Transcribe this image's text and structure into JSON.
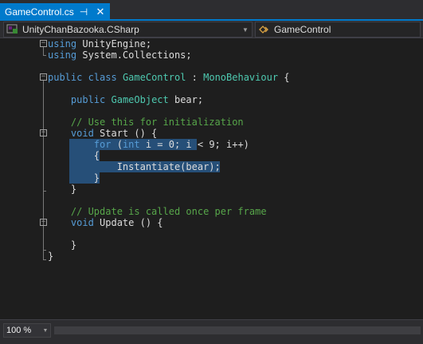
{
  "tab": {
    "title": "GameControl.cs",
    "pin_glyph": "⊣",
    "close_glyph": "✕"
  },
  "navbar": {
    "project": "UnityChanBazooka.CSharp",
    "member": "GameControl",
    "arrow": "▼"
  },
  "code": {
    "lines": [
      [
        [
          "kw",
          "using"
        ],
        [
          "tx",
          " UnityEngine;"
        ]
      ],
      [
        [
          "kw",
          "using"
        ],
        [
          "tx",
          " System.Collections;"
        ]
      ],
      [],
      [
        [
          "kw",
          "public"
        ],
        [
          "tx",
          " "
        ],
        [
          "kw",
          "class"
        ],
        [
          "tx",
          " "
        ],
        [
          "ty",
          "GameControl"
        ],
        [
          "tx",
          " : "
        ],
        [
          "ty",
          "MonoBehaviour"
        ],
        [
          "tx",
          " {"
        ]
      ],
      [],
      [
        [
          "tx",
          "    "
        ],
        [
          "kw",
          "public"
        ],
        [
          "tx",
          " "
        ],
        [
          "ty",
          "GameObject"
        ],
        [
          "tx",
          " bear;"
        ]
      ],
      [],
      [
        [
          "tx",
          "    "
        ],
        [
          "cm",
          "// Use this for initialization"
        ]
      ],
      [
        [
          "tx",
          "    "
        ],
        [
          "kw",
          "void"
        ],
        [
          "tx",
          " Start () {"
        ]
      ],
      [
        [
          "tx",
          "        "
        ],
        [
          "kw",
          "for"
        ],
        [
          "tx",
          " ("
        ],
        [
          "kw",
          "int"
        ],
        [
          "tx",
          " i = 0; i < 9; i++)"
        ]
      ],
      [
        [
          "tx",
          "        {"
        ]
      ],
      [
        [
          "tx",
          "            Instantiate(bear);"
        ]
      ],
      [
        [
          "tx",
          "        }"
        ]
      ],
      [
        [
          "tx",
          "    }"
        ]
      ],
      [],
      [
        [
          "tx",
          "    "
        ],
        [
          "cm",
          "// Update is called once per frame"
        ]
      ],
      [
        [
          "tx",
          "    "
        ],
        [
          "kw",
          "void"
        ],
        [
          "tx",
          " Update () {"
        ]
      ],
      [],
      [
        [
          "tx",
          "    }"
        ]
      ],
      [
        [
          "tx",
          "}"
        ]
      ]
    ]
  },
  "zoom": {
    "value": "100 %",
    "arrow": "▼"
  },
  "colors": {
    "accent": "#007acc",
    "keyword": "#569cd6",
    "type": "#4ec9b0",
    "comment": "#57a64a",
    "selection": "#264f78",
    "background": "#1e1e1e"
  }
}
